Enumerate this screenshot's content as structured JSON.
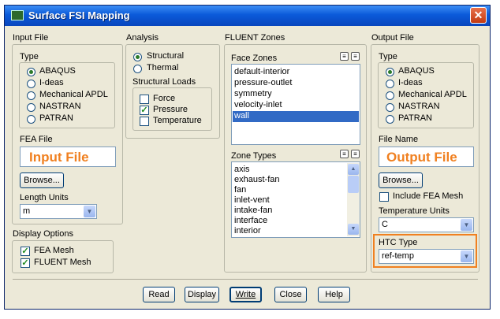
{
  "window": {
    "title": "Surface FSI Mapping",
    "close": "✕"
  },
  "input_file": {
    "group_label": "Input File",
    "type_label": "Type",
    "types": [
      "ABAQUS",
      "I-deas",
      "Mechanical APDL",
      "NASTRAN",
      "PATRAN"
    ],
    "selected_type": "ABAQUS",
    "fea_file_label": "FEA File",
    "fea_file_value": "Input File",
    "browse_label": "Browse...",
    "length_units_label": "Length Units",
    "length_units_value": "m"
  },
  "display_options": {
    "group_label": "Display Options",
    "fea_mesh": "FEA Mesh",
    "fluent_mesh": "FLUENT Mesh"
  },
  "analysis": {
    "group_label": "Analysis",
    "structural": "Structural",
    "thermal": "Thermal",
    "structural_loads_label": "Structural Loads",
    "force": "Force",
    "pressure": "Pressure",
    "temperature": "Temperature"
  },
  "fluent_zones": {
    "group_label": "FLUENT Zones",
    "face_zones_label": "Face Zones",
    "face_zones": [
      "default-interior",
      "pressure-outlet",
      "symmetry",
      "velocity-inlet",
      "wall"
    ],
    "selected_face_zone": "wall",
    "zone_types_label": "Zone Types",
    "zone_types": [
      "axis",
      "exhaust-fan",
      "fan",
      "inlet-vent",
      "intake-fan",
      "interface",
      "interior"
    ]
  },
  "output_file": {
    "group_label": "Output File",
    "type_label": "Type",
    "types": [
      "ABAQUS",
      "I-deas",
      "Mechanical APDL",
      "NASTRAN",
      "PATRAN"
    ],
    "selected_type": "ABAQUS",
    "file_name_label": "File Name",
    "file_name_value": "Output File",
    "browse_label": "Browse...",
    "include_fea_mesh": "Include FEA Mesh",
    "temperature_units_label": "Temperature Units",
    "temperature_units_value": "C",
    "htc_type_label": "HTC Type",
    "htc_type_value": "ref-temp"
  },
  "buttons": {
    "read": "Read",
    "display": "Display",
    "write": "Write",
    "close": "Close",
    "help": "Help"
  },
  "colors": {
    "title_blue": "#0b5ad9",
    "highlight_orange": "#f08020",
    "selection_blue": "#316ac5"
  }
}
